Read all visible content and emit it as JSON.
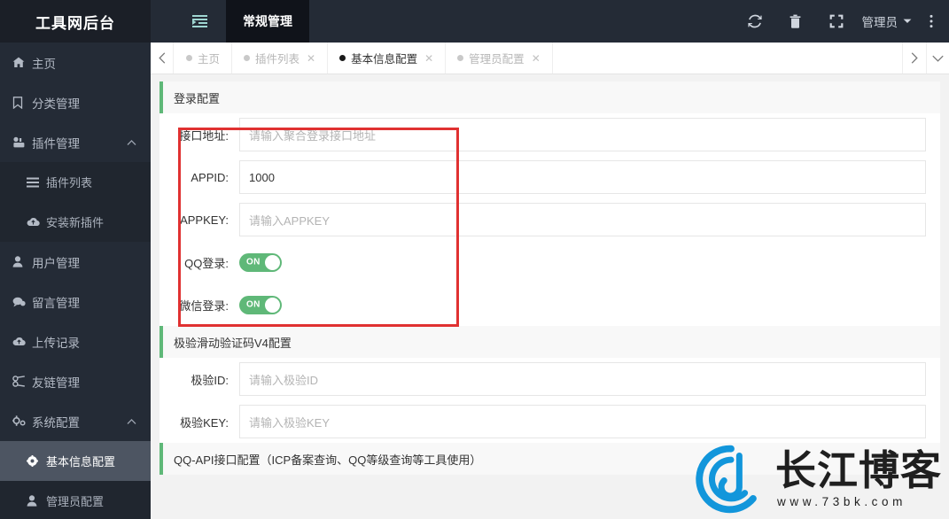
{
  "sidebar": {
    "logo": "工具网后台",
    "items": [
      {
        "label": "主页",
        "icon": "home-icon",
        "level": 1,
        "expandable": false
      },
      {
        "label": "分类管理",
        "icon": "bookmark-icon",
        "level": 1,
        "expandable": false
      },
      {
        "label": "插件管理",
        "icon": "plugin-icon",
        "level": 1,
        "expandable": true,
        "expanded": true
      },
      {
        "label": "插件列表",
        "icon": "list-icon",
        "level": 2,
        "active": false
      },
      {
        "label": "安装新插件",
        "icon": "cloud-upload-icon",
        "level": 2,
        "active": false
      },
      {
        "label": "用户管理",
        "icon": "user-icon",
        "level": 1,
        "expandable": false
      },
      {
        "label": "留言管理",
        "icon": "comment-icon",
        "level": 1,
        "expandable": false
      },
      {
        "label": "上传记录",
        "icon": "cloud-icon",
        "level": 1,
        "expandable": false
      },
      {
        "label": "友链管理",
        "icon": "link-icon",
        "level": 1,
        "expandable": false
      },
      {
        "label": "系统配置",
        "icon": "gear-group-icon",
        "level": 1,
        "expandable": true,
        "expanded": true
      },
      {
        "label": "基本信息配置",
        "icon": "gear-icon",
        "level": 2,
        "active": true
      },
      {
        "label": "管理员配置",
        "icon": "user-icon",
        "level": 2,
        "active": false
      }
    ]
  },
  "topbar": {
    "collapse_icon": "indent-icon",
    "nav": [
      {
        "label": "常规管理",
        "active": true
      }
    ],
    "actions": [
      {
        "name": "refresh-icon"
      },
      {
        "name": "trash-icon"
      },
      {
        "name": "fullscreen-icon"
      }
    ],
    "user": "管理员",
    "more_icon": "more-vertical-icon"
  },
  "tabstrip": {
    "prev_label": "‹",
    "next_label": "›",
    "dropdown_label": "⌄",
    "tabs": [
      {
        "label": "主页",
        "active": false,
        "closable": false
      },
      {
        "label": "插件列表",
        "active": false,
        "closable": true
      },
      {
        "label": "基本信息配置",
        "active": true,
        "closable": true
      },
      {
        "label": "管理员配置",
        "active": false,
        "closable": true
      }
    ]
  },
  "main": {
    "sections": [
      {
        "title": "登录配置",
        "rows": [
          {
            "label": "接口地址:",
            "type": "text",
            "value": "",
            "placeholder": "请输入聚合登录接口地址"
          },
          {
            "label": "APPID:",
            "type": "text",
            "value": "1000",
            "placeholder": ""
          },
          {
            "label": "APPKEY:",
            "type": "text",
            "value": "",
            "placeholder": "请输入APPKEY"
          },
          {
            "label": "QQ登录:",
            "type": "switch",
            "value": "ON"
          },
          {
            "label": "微信登录:",
            "type": "switch",
            "value": "ON"
          }
        ]
      },
      {
        "title": "极验滑动验证码V4配置",
        "rows": [
          {
            "label": "极验ID:",
            "type": "text",
            "value": "",
            "placeholder": "请输入极验ID"
          },
          {
            "label": "极验KEY:",
            "type": "text",
            "value": "",
            "placeholder": "请输入极验KEY"
          }
        ]
      },
      {
        "title": "QQ-API接口配置（ICP备案查询、QQ等级查询等工具使用）",
        "rows": []
      }
    ]
  },
  "watermark": {
    "title": "长江博客",
    "url": "www.73bk.com"
  },
  "colors": {
    "sidebar_bg": "#242b36",
    "sidebar_active": "#4d5562",
    "topbar_bg": "#242b36",
    "topbar_active": "#10131a",
    "accent_green": "#5FB878",
    "highlight_red": "#e03131",
    "content_bg": "#f2f2f2",
    "watermark_blue": "#1296db"
  }
}
